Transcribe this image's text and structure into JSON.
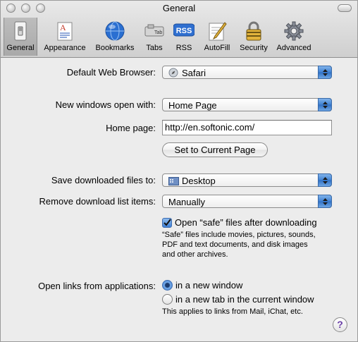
{
  "window": {
    "title": "General"
  },
  "toolbar": {
    "items": [
      {
        "label": "General",
        "icon": "light-switch-icon",
        "selected": true
      },
      {
        "label": "Appearance",
        "icon": "appearance-icon",
        "selected": false
      },
      {
        "label": "Bookmarks",
        "icon": "globe-icon",
        "selected": false
      },
      {
        "label": "Tabs",
        "icon": "tabs-icon",
        "selected": false
      },
      {
        "label": "RSS",
        "icon": "rss-icon",
        "selected": false
      },
      {
        "label": "AutoFill",
        "icon": "autofill-pen-icon",
        "selected": false
      },
      {
        "label": "Security",
        "icon": "padlock-icon",
        "selected": false
      },
      {
        "label": "Advanced",
        "icon": "gear-icon",
        "selected": false
      }
    ],
    "tabs_icon_text": "Tab",
    "rss_icon_text": "RSS"
  },
  "general": {
    "default_browser_label": "Default Web Browser:",
    "default_browser_value": "Safari",
    "new_windows_label": "New windows open with:",
    "new_windows_value": "Home Page",
    "home_page_label": "Home page:",
    "home_page_value": "http://en.softonic.com/",
    "set_current_button": "Set to Current Page",
    "save_downloads_label": "Save downloaded files to:",
    "save_downloads_value": "Desktop",
    "remove_items_label": "Remove download list items:",
    "remove_items_value": "Manually",
    "open_safe_label": "Open “safe” files after downloading",
    "open_safe_checked": true,
    "safe_note": [
      "“Safe” files include movies, pictures, sounds,",
      "PDF and text documents, and disk images",
      "and other archives."
    ],
    "open_links_label": "Open links from applications:",
    "radio_new_window": "in a new window",
    "radio_new_tab": "in a new tab in the current window",
    "radio_selected": "new_window",
    "links_note": "This applies to links from Mail, iChat, etc.",
    "help_label": "?"
  },
  "colors": {
    "accent": "#3f80d4",
    "window_bg": "#ececec"
  }
}
